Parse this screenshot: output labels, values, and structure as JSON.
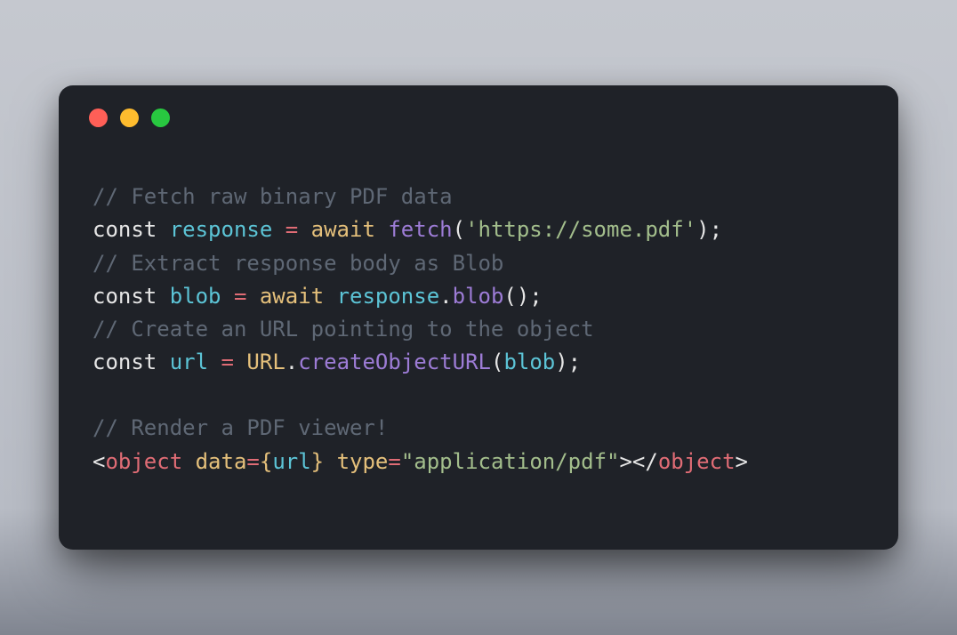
{
  "traffic_lights": [
    "red",
    "yellow",
    "green"
  ],
  "code": {
    "lines": [
      {
        "t": "comment",
        "text": "// Fetch raw binary PDF data"
      },
      {
        "t": "stmt",
        "tokens": [
          {
            "c": "kw",
            "v": "const"
          },
          {
            "c": "punc",
            "v": " "
          },
          {
            "c": "var",
            "v": "response"
          },
          {
            "c": "punc",
            "v": " "
          },
          {
            "c": "op",
            "v": "="
          },
          {
            "c": "punc",
            "v": " "
          },
          {
            "c": "await",
            "v": "await"
          },
          {
            "c": "punc",
            "v": " "
          },
          {
            "c": "fn",
            "v": "fetch"
          },
          {
            "c": "punc",
            "v": "("
          },
          {
            "c": "str",
            "v": "'https://some.pdf'"
          },
          {
            "c": "punc",
            "v": ");"
          }
        ]
      },
      {
        "t": "comment",
        "text": "// Extract response body as Blob"
      },
      {
        "t": "stmt",
        "tokens": [
          {
            "c": "kw",
            "v": "const"
          },
          {
            "c": "punc",
            "v": " "
          },
          {
            "c": "var",
            "v": "blob"
          },
          {
            "c": "punc",
            "v": " "
          },
          {
            "c": "op",
            "v": "="
          },
          {
            "c": "punc",
            "v": " "
          },
          {
            "c": "await",
            "v": "await"
          },
          {
            "c": "punc",
            "v": " "
          },
          {
            "c": "var",
            "v": "response"
          },
          {
            "c": "punc",
            "v": "."
          },
          {
            "c": "fn",
            "v": "blob"
          },
          {
            "c": "punc",
            "v": "();"
          }
        ]
      },
      {
        "t": "comment",
        "text": "// Create an URL pointing to the object"
      },
      {
        "t": "stmt",
        "tokens": [
          {
            "c": "kw",
            "v": "const"
          },
          {
            "c": "punc",
            "v": " "
          },
          {
            "c": "var",
            "v": "url"
          },
          {
            "c": "punc",
            "v": " "
          },
          {
            "c": "op",
            "v": "="
          },
          {
            "c": "punc",
            "v": " "
          },
          {
            "c": "class",
            "v": "URL"
          },
          {
            "c": "punc",
            "v": "."
          },
          {
            "c": "fn",
            "v": "createObjectURL"
          },
          {
            "c": "punc",
            "v": "("
          },
          {
            "c": "var",
            "v": "blob"
          },
          {
            "c": "punc",
            "v": ");"
          }
        ]
      },
      {
        "t": "blank"
      },
      {
        "t": "comment",
        "text": "// Render a PDF viewer!"
      },
      {
        "t": "stmt",
        "tokens": [
          {
            "c": "punc",
            "v": "<"
          },
          {
            "c": "tag",
            "v": "object"
          },
          {
            "c": "punc",
            "v": " "
          },
          {
            "c": "attr",
            "v": "data"
          },
          {
            "c": "op",
            "v": "="
          },
          {
            "c": "brace",
            "v": "{"
          },
          {
            "c": "var",
            "v": "url"
          },
          {
            "c": "brace",
            "v": "}"
          },
          {
            "c": "punc",
            "v": " "
          },
          {
            "c": "attr",
            "v": "type"
          },
          {
            "c": "op",
            "v": "="
          },
          {
            "c": "str",
            "v": "\"application/pdf\""
          },
          {
            "c": "punc",
            "v": ">"
          },
          {
            "c": "punc",
            "v": "</"
          },
          {
            "c": "tag",
            "v": "object"
          },
          {
            "c": "punc",
            "v": ">"
          }
        ]
      }
    ]
  }
}
